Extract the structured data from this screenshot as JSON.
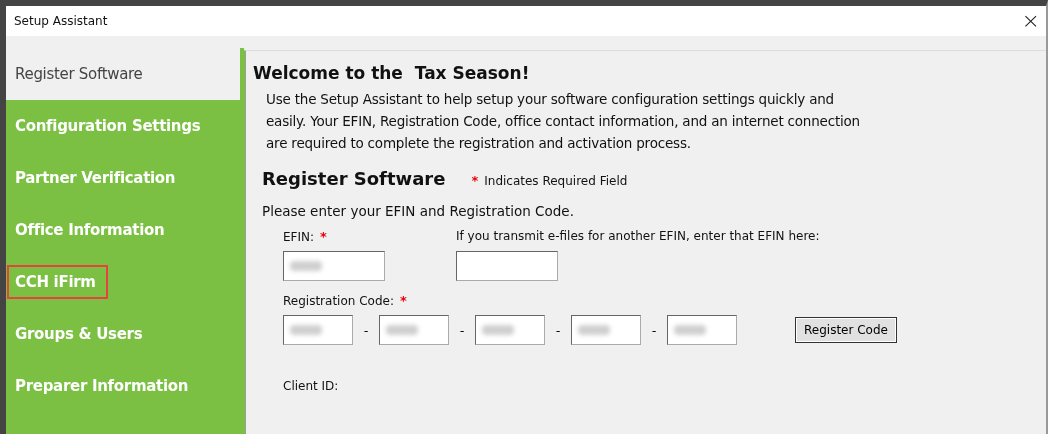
{
  "window": {
    "title": "Setup Assistant",
    "close": "×"
  },
  "sidebar": {
    "items": [
      {
        "label": "Register Software",
        "selected": true,
        "highlighted": false
      },
      {
        "label": "Configuration Settings",
        "selected": false,
        "highlighted": false
      },
      {
        "label": "Partner Verification",
        "selected": false,
        "highlighted": false
      },
      {
        "label": "Office Information",
        "selected": false,
        "highlighted": false
      },
      {
        "label": "CCH iFirm",
        "selected": false,
        "highlighted": true
      },
      {
        "label": "Groups & Users",
        "selected": false,
        "highlighted": false
      },
      {
        "label": "Preparer Information",
        "selected": false,
        "highlighted": false
      }
    ]
  },
  "content": {
    "heading": "Welcome to the  Tax Season!",
    "intro": [
      "Use the Setup Assistant to help setup your software configuration settings quickly and",
      "easily.  Your EFIN, Registration Code, office contact information, and an internet connection",
      "are required to complete the registration and activation process."
    ],
    "section_title": "Register Software",
    "required_marker": "*",
    "required_note": "Indicates Required Field",
    "instruction": "Please enter your EFIN and Registration Code.",
    "efin": {
      "label": "EFIN:",
      "required": true,
      "blurred": true
    },
    "other_efin": {
      "label": "If you transmit e-files for another EFIN, enter that EFIN here:",
      "required": false,
      "blurred": false
    },
    "registration_code": {
      "label": "Registration Code:",
      "required": true,
      "separator": "-",
      "parts": [
        {
          "blurred": true
        },
        {
          "blurred": true
        },
        {
          "blurred": true
        },
        {
          "blurred": true
        },
        {
          "blurred": true
        }
      ]
    },
    "register_button": "Register Code",
    "client_id": {
      "label": "Client ID:"
    }
  }
}
